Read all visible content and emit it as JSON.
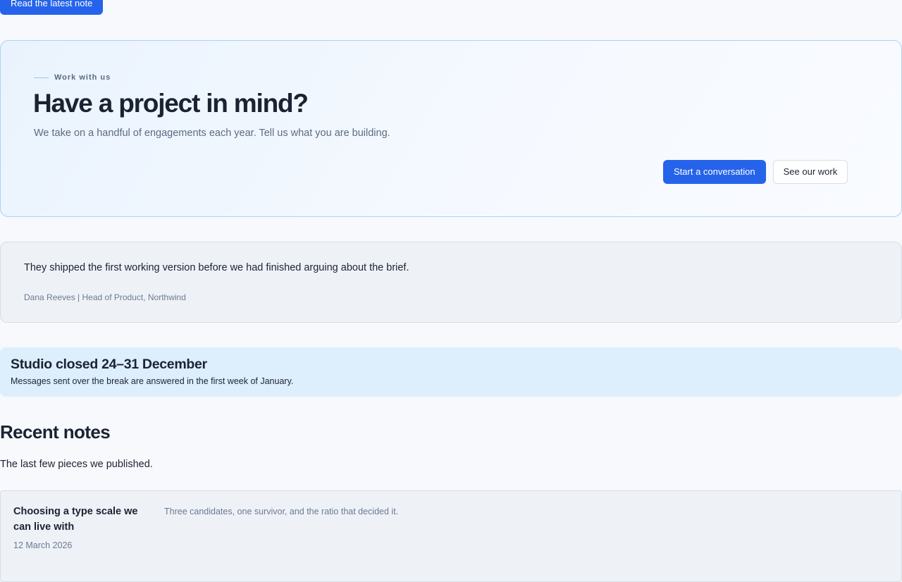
{
  "top_button": {
    "label": "Read the latest note"
  },
  "cta": {
    "eyebrow": "Work with us",
    "title": "Have a project in mind?",
    "subtitle": "We take on a handful of engagements each year. Tell us what you are building.",
    "primary_label": "Start a conversation",
    "secondary_label": "See our work"
  },
  "testimonial": {
    "quote": "They shipped the first working version before we had finished arguing about the brief.",
    "citation": "Dana Reeves | Head of Product, Northwind"
  },
  "notice": {
    "title": "Studio closed 24–31 December",
    "body": "Messages sent over the break are answered in the first week of January."
  },
  "recent_notes": {
    "title": "Recent notes",
    "subtitle": "The last few pieces we published.",
    "items": [
      {
        "title": "Choosing a type scale we can live with",
        "date": "12 March 2026",
        "excerpt": "Three candidates, one survivor, and the ratio that decided it."
      }
    ]
  },
  "colors": {
    "accent": "#2563eb",
    "page_background": "#f7f9fc",
    "cta_border": "#a9d3f2",
    "notice_background": "#ddeffc",
    "card_background": "#eef2f7"
  }
}
